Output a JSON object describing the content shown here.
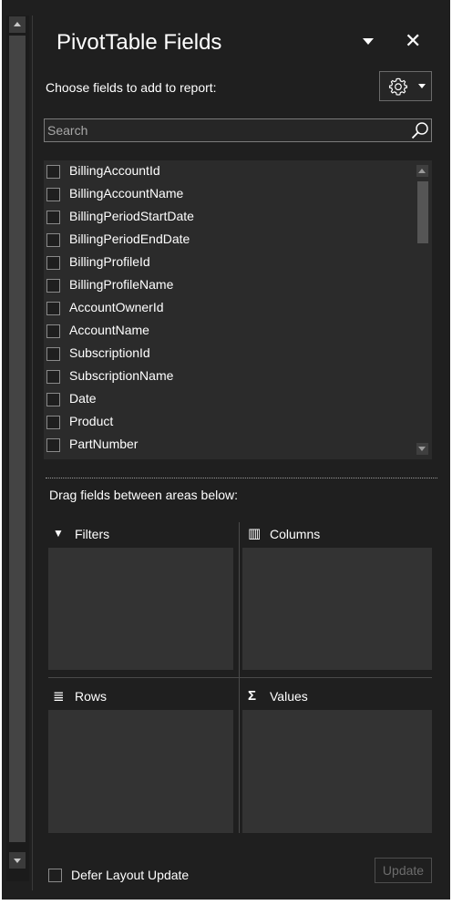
{
  "header": {
    "title": "PivotTable Fields",
    "close_glyph": "✕",
    "choose_label": "Choose fields to add to report:"
  },
  "search": {
    "placeholder": "Search",
    "value": ""
  },
  "fields": [
    {
      "label": "BillingAccountId",
      "checked": false
    },
    {
      "label": "BillingAccountName",
      "checked": false
    },
    {
      "label": "BillingPeriodStartDate",
      "checked": false
    },
    {
      "label": "BillingPeriodEndDate",
      "checked": false
    },
    {
      "label": "BillingProfileId",
      "checked": false
    },
    {
      "label": "BillingProfileName",
      "checked": false
    },
    {
      "label": "AccountOwnerId",
      "checked": false
    },
    {
      "label": "AccountName",
      "checked": false
    },
    {
      "label": "SubscriptionId",
      "checked": false
    },
    {
      "label": "SubscriptionName",
      "checked": false
    },
    {
      "label": "Date",
      "checked": false
    },
    {
      "label": "Product",
      "checked": false
    },
    {
      "label": "PartNumber",
      "checked": false
    }
  ],
  "areas": {
    "drag_label": "Drag fields between areas below:",
    "filters": {
      "label": "Filters",
      "icon": "filter-icon",
      "glyph": "▼"
    },
    "columns": {
      "label": "Columns",
      "icon": "columns-icon",
      "glyph": "▥"
    },
    "rows": {
      "label": "Rows",
      "icon": "rows-icon",
      "glyph": "≣"
    },
    "values": {
      "label": "Values",
      "icon": "sigma-icon",
      "glyph": "Σ"
    }
  },
  "footer": {
    "defer_label": "Defer Layout Update",
    "defer_checked": false,
    "update_label": "Update"
  },
  "colors": {
    "background": "#1f1f1f",
    "list_background": "#2b2b2b",
    "area_background": "#333333",
    "text": "#ffffff",
    "disabled_text": "#6c6c6c"
  }
}
